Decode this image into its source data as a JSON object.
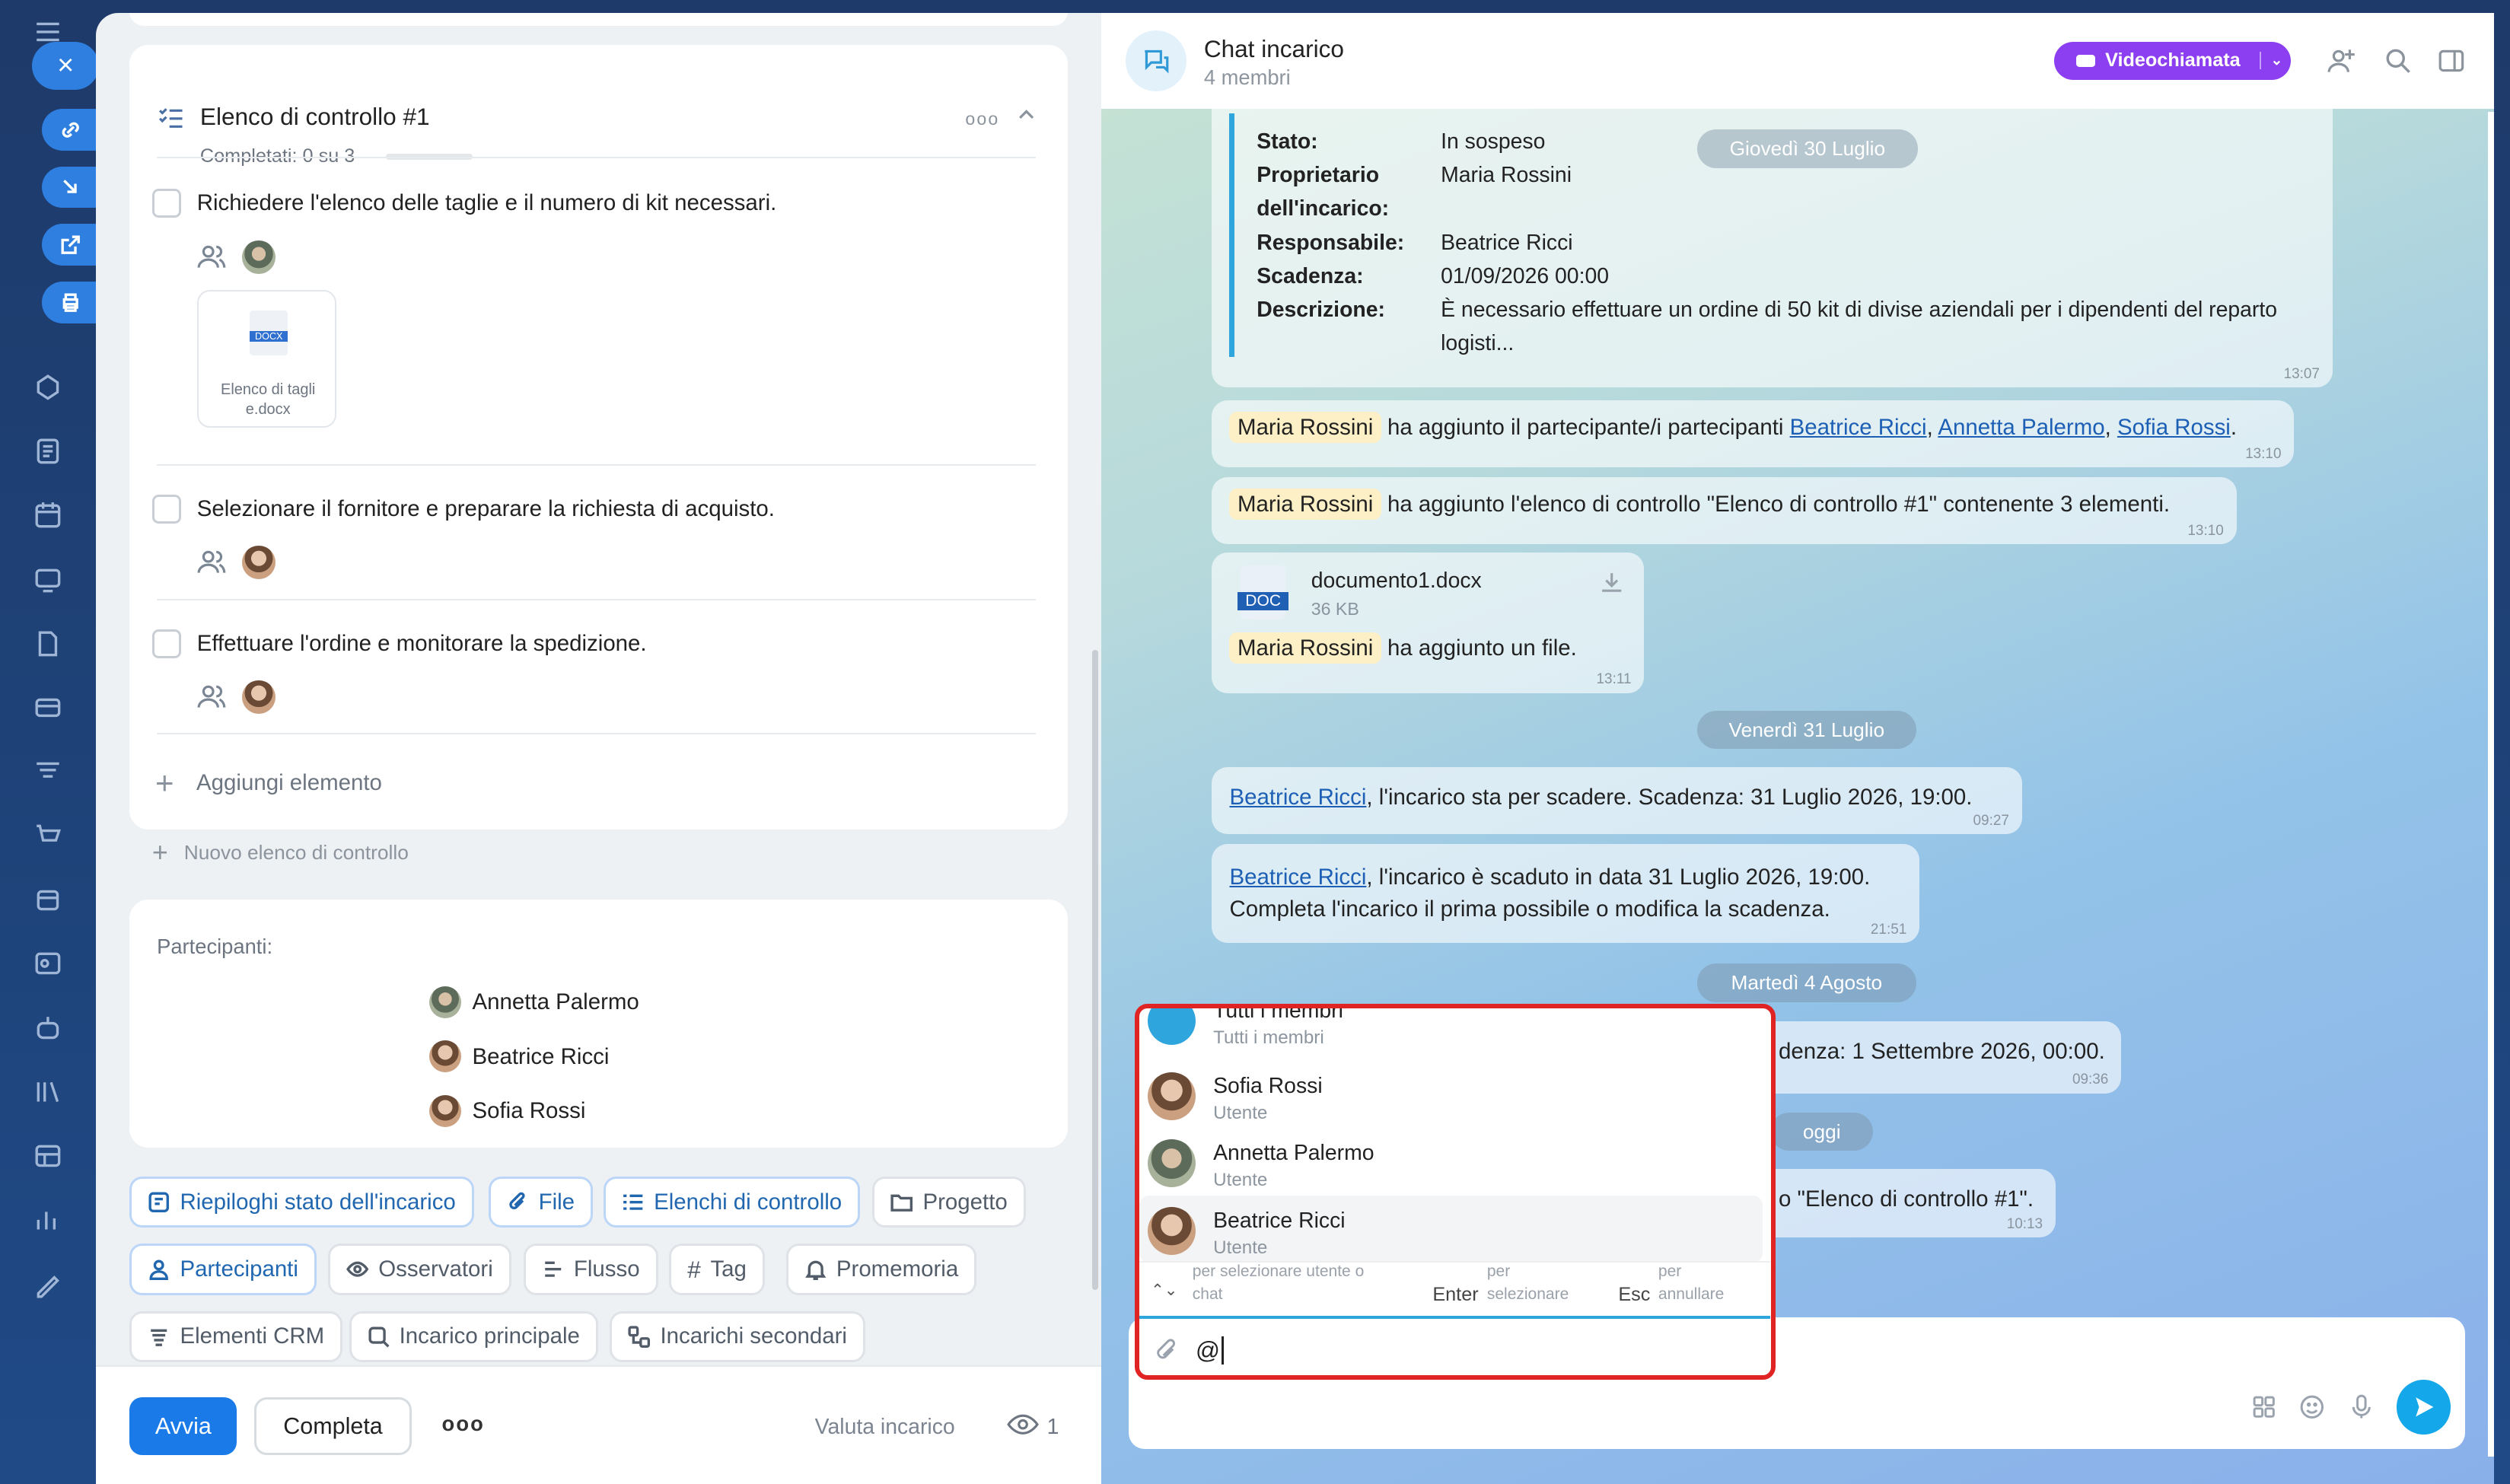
{
  "checklist": {
    "title": "Elenco di controllo #1",
    "progress_text": "Completati: 0 su 3",
    "progress": 0,
    "items": [
      {
        "text": "Richiedere l'elenco delle taglie e il numero di kit necessari."
      },
      {
        "text": "Selezionare il fornitore e preparare la richiesta di acquisto."
      },
      {
        "text": "Effettuare l'ordine e monitorare la spedizione."
      }
    ],
    "file": {
      "ext": "DOCX",
      "name": "Elenco di tagli",
      "name2": "e.docx"
    },
    "add_item": "Aggiungi elemento",
    "new_checklist": "Nuovo elenco di controllo"
  },
  "participants": {
    "label": "Partecipanti:",
    "list": [
      "Annetta Palermo",
      "Beatrice Ricci",
      "Sofia Rossi"
    ]
  },
  "tabs": [
    "Riepiloghi stato dell'incarico",
    "File",
    "Elenchi di controllo",
    "Progetto",
    "Partecipanti",
    "Osservatori",
    "Flusso",
    "Tag",
    "Promemoria",
    "Elementi CRM",
    "Incarico principale",
    "Incarichi secondari"
  ],
  "footer": {
    "start": "Avvia",
    "complete": "Completa",
    "more": "ooo",
    "rate": "Valuta incarico",
    "views": "1"
  },
  "chat": {
    "title": "Chat incarico",
    "members": "4 membri",
    "video": "Videochiamata",
    "info": [
      [
        "Stato:",
        "In sospeso"
      ],
      [
        "Proprietario",
        "Maria Rossini"
      ],
      [
        "dell'incarico:",
        ""
      ],
      [
        "Responsabile:",
        "Beatrice Ricci"
      ],
      [
        "Scadenza:",
        "01/09/2026 00:00"
      ],
      [
        "Descrizione:",
        "È necessario effettuare un ordine di 50 kit di divise aziendali per i dipendenti del reparto"
      ],
      [
        "",
        "logisti..."
      ]
    ],
    "info_time": "13:07",
    "dates": [
      "Giovedì 30 Luglio",
      "Venerdì 31 Luglio",
      "Martedì 4 Agosto",
      "oggi"
    ],
    "m1": {
      "who": "Maria Rossini",
      "text": "ha aggiunto il partecipante/i partecipanti",
      "l1": "Beatrice Ricci",
      "c1": ",",
      "l2": "Annetta Palermo",
      "c2": ",",
      "l3": "Sofia Rossi",
      "end": ".",
      "time": "13:10"
    },
    "m2": {
      "who": "Maria Rossini",
      "text": "ha aggiunto l'elenco di controllo \"Elenco di controllo #1\" contenente 3 elementi.",
      "time": "13:10"
    },
    "m3": {
      "ext": "DOC",
      "file": "documento1.docx",
      "size": "36 KB",
      "who": "Maria Rossini",
      "text": "ha aggiunto un file.",
      "time": "13:11"
    },
    "m4": {
      "link": "Beatrice Ricci",
      "text": ", l'incarico sta per scadere. Scadenza: 31 Luglio 2026, 19:00.",
      "time": "09:27"
    },
    "m5": {
      "link": "Beatrice Ricci",
      "text": ", l'incarico è scaduto in data 31 Luglio 2026, 19:00.",
      "line2": "Completa l'incarico il prima possibile o modifica la scadenza.",
      "time": "21:51"
    },
    "m6": {
      "text": "denza: 1 Settembre 2026, 00:00.",
      "time": "09:36"
    },
    "m7": {
      "text": "o \"Elenco di controllo #1\".",
      "time": "10:13"
    },
    "input": "@"
  },
  "mention": {
    "items": [
      {
        "name": "Tutti i membri",
        "role": "Tutti i membri"
      },
      {
        "name": "Sofia Rossi",
        "role": "Utente"
      },
      {
        "name": "Annetta Palermo",
        "role": "Utente"
      },
      {
        "name": "Beatrice Ricci",
        "role": "Utente"
      }
    ],
    "hint1a": "per selezionare utente o",
    "hint1b": "chat",
    "enter": "Enter",
    "hint2a": "per",
    "hint2b": "selezionare",
    "esc": "Esc",
    "hint3a": "per",
    "hint3b": "annullare"
  }
}
